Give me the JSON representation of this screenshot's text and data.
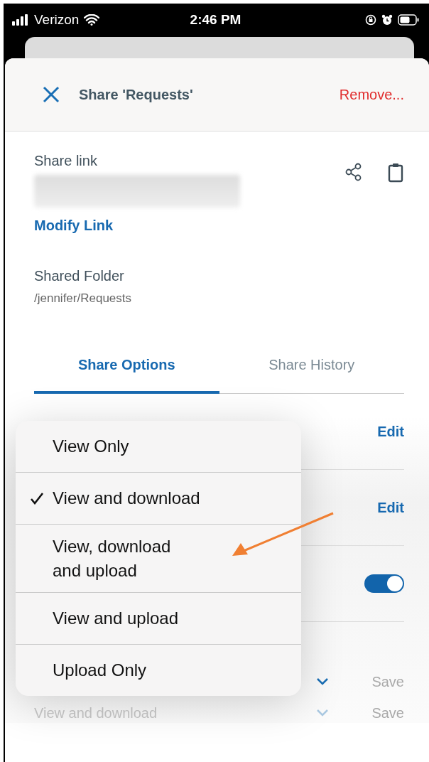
{
  "status_bar": {
    "carrier": "Verizon",
    "time": "2:46 PM"
  },
  "header": {
    "title": "Share 'Requests'",
    "action": "Remove..."
  },
  "share_link": {
    "label": "Share link",
    "link_action": "Modify Link"
  },
  "shared_folder": {
    "label": "Shared Folder",
    "path": "/jennifer/Requests"
  },
  "tabs": [
    {
      "label": "Share Options",
      "selected": true
    },
    {
      "label": "Share History",
      "selected": false
    }
  ],
  "option_rows": [
    {
      "kind": "edit",
      "action": "Edit"
    },
    {
      "kind": "edit",
      "action": "Edit"
    },
    {
      "kind": "toggle",
      "on": true
    }
  ],
  "permission_rows": [
    {
      "disabled": false,
      "action": "Save"
    },
    {
      "disabled": true,
      "value": "View and download",
      "action": "Save"
    }
  ],
  "menu": {
    "items": [
      {
        "label": "View Only",
        "selected": false
      },
      {
        "label": "View and download",
        "selected": true
      },
      {
        "label": "View, download\nand upload",
        "selected": false
      },
      {
        "label": "View and upload",
        "selected": false
      },
      {
        "label": "Upload Only",
        "selected": false
      }
    ]
  }
}
